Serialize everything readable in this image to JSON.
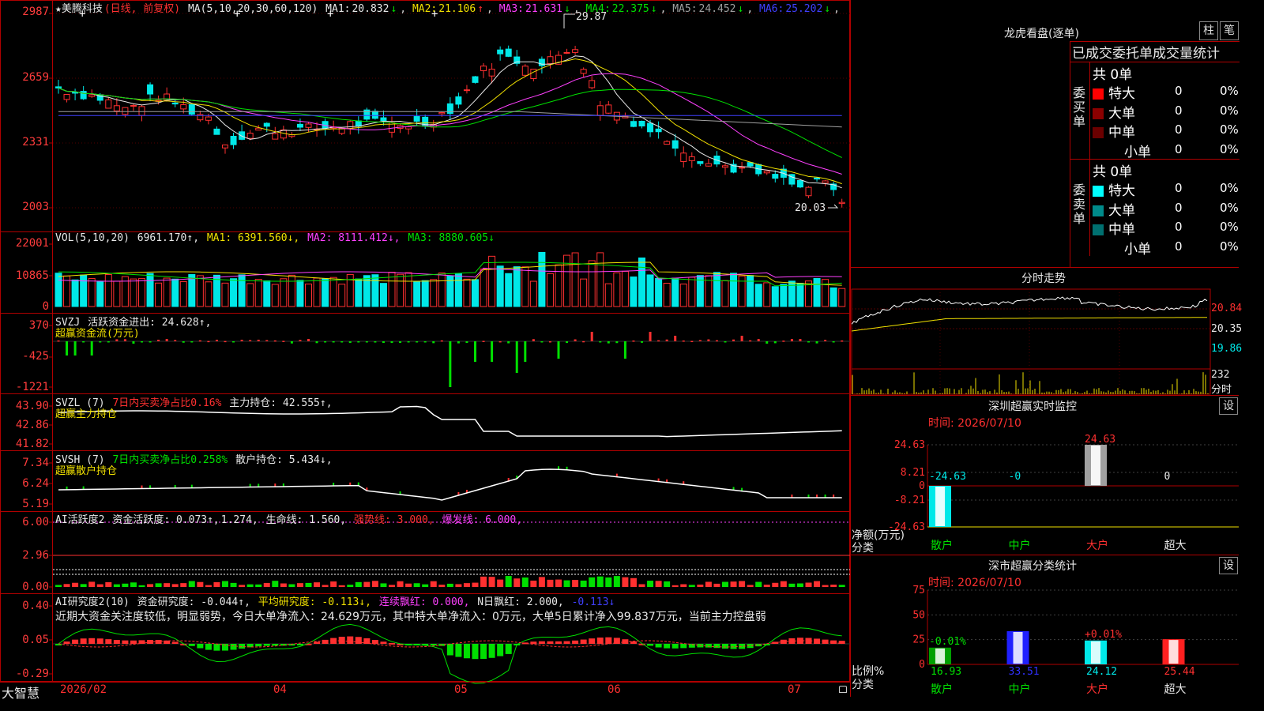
{
  "colors": {
    "up": "#ff3030",
    "down": "#00e8e8",
    "grid": "#b00000",
    "bg": "#000000"
  },
  "main": {
    "stock_name": "★美腾科技",
    "mode": "(日线, 前复权)",
    "ma_title": "MA(5,10,20,30,60,120)",
    "ma": [
      {
        "label": "MA1:",
        "value": "20.832",
        "arrow": "↓",
        "color": "#e8e8e8"
      },
      {
        "label": "MA2:",
        "value": "21.106",
        "arrow": "↑",
        "color": "#f0e000"
      },
      {
        "label": "MA3:",
        "value": "21.631",
        "arrow": "↓",
        "color": "#ff40ff"
      },
      {
        "label": "MA4:",
        "value": "22.375",
        "arrow": "↓",
        "color": "#00e000"
      },
      {
        "label": "MA5:",
        "value": "24.452",
        "arrow": "↓",
        "color": "#a0a0a0"
      },
      {
        "label": "MA6:",
        "value": "25.202",
        "arrow": "↓",
        "color": "#4040ff"
      }
    ],
    "y_ticks": [
      "2987",
      "2659",
      "2331",
      "2003"
    ],
    "high_label": "29.87",
    "low_label": "20.03"
  },
  "vol": {
    "title": "VOL(5,10,20)",
    "value": "6961.170↑,",
    "ma1": "MA1: 6391.560↓,",
    "ma2": "MA2: 8111.412↓,",
    "ma3": "MA3: 8880.605↓",
    "y_ticks": [
      "22001",
      "10865",
      "0"
    ]
  },
  "svzj": {
    "title": "SVZJ",
    "label": "活跃资金进出: 24.628↑,",
    "sub": "超赢资金流(万元)",
    "y_ticks": [
      "370",
      "-425",
      "-1221"
    ]
  },
  "svzl": {
    "title": "SVZL (7)",
    "p1": "7日内买卖净占比0.16%",
    "p2": "主力持仓: 42.555↑,",
    "sub": "超赢主力持仓",
    "y_ticks": [
      "43.90",
      "42.86",
      "41.82"
    ]
  },
  "svsh": {
    "title": "SVSH (7)",
    "p1": "7日内买卖净占比0.258%",
    "p2": "散户持仓: 5.434↓,",
    "sub": "超赢散户持仓",
    "y_ticks": [
      "7.34",
      "6.24",
      "5.19"
    ]
  },
  "ai1": {
    "title": "AI活跃度2",
    "p1": "资金活跃度: 0.073↑,",
    "p2": "1.274,",
    "p3": "生命线: 1.560,",
    "p4": "强势线: 3.000,",
    "p5": "爆发线: 6.000,",
    "y_ticks": [
      "6.00",
      "2.96",
      "0.00"
    ]
  },
  "ai2": {
    "title": "AI研究度2(10)",
    "p1": "资金研究度: -0.044↑,",
    "p2": "平均研究度: -0.113↓,",
    "p3": "连续飘红: 0.000,",
    "p4": "N日飘红: 2.000,",
    "p5": "-0.113↓",
    "note": "近期大资金关注度较低，明显弱势，今日大单净流入：24.629万元，其中特大单净流入：0万元，大单5日累计净入99.837万元，当前主力控盘弱",
    "y_ticks": [
      "0.40",
      "0.05",
      "-0.29"
    ]
  },
  "xaxis": {
    "brand": "大智慧",
    "labels": [
      "2026/02",
      "04",
      "05",
      "06",
      "07"
    ]
  },
  "right": {
    "title": "龙虎看盘(逐单)",
    "btn_zhu": "柱",
    "btn_bi": "笔",
    "header": "已成交委托单成交量统计",
    "buy_label": "委买单",
    "sell_label": "委卖单",
    "buy_total": "共 0单",
    "sell_total": "共 0单",
    "rows": [
      "特大",
      "大单",
      "中单",
      "小单"
    ],
    "zero": "0",
    "pct": "0%",
    "buy_colors": [
      "#ff0000",
      "#8b0000",
      "#6b0000",
      ""
    ],
    "sell_colors": [
      "#00ffff",
      "#008b8b",
      "#007070",
      ""
    ],
    "fenshi_title": "分时走势",
    "fenshi_ticks": [
      "20.84",
      "20.35",
      "19.86"
    ],
    "fenshi_vol": "232",
    "fenshi_unit": "分时"
  },
  "sz_monitor": {
    "title": "深圳超赢实时监控",
    "set": "设",
    "time": "时间: 2026/07/10",
    "y_ticks": [
      "24.63",
      "8.21",
      "0",
      "-8.21",
      "-24.63"
    ],
    "ylabel": "净额(万元)",
    "xlabel": "分类",
    "cats": [
      "散户",
      "中户",
      "大户",
      "超大"
    ],
    "value_labels": [
      "-24.63",
      "-0",
      "24.63",
      "0"
    ],
    "values": [
      -24.63,
      0,
      24.63,
      0
    ]
  },
  "sc_stats": {
    "title": "深市超赢分类统计",
    "set": "设",
    "time": "时间: 2026/07/10",
    "y_ticks": [
      "75",
      "50",
      "25",
      "0"
    ],
    "ylabel": "比例%",
    "xlabel": "分类",
    "cats": [
      "散户",
      "中户",
      "大户",
      "超大"
    ],
    "top_labels": [
      "-0.01%",
      "",
      "+0.01%",
      ""
    ],
    "values": [
      16.93,
      33.51,
      24.12,
      25.44
    ],
    "value_labels": [
      "16.93",
      "33.51",
      "24.12",
      "25.44"
    ]
  }
}
